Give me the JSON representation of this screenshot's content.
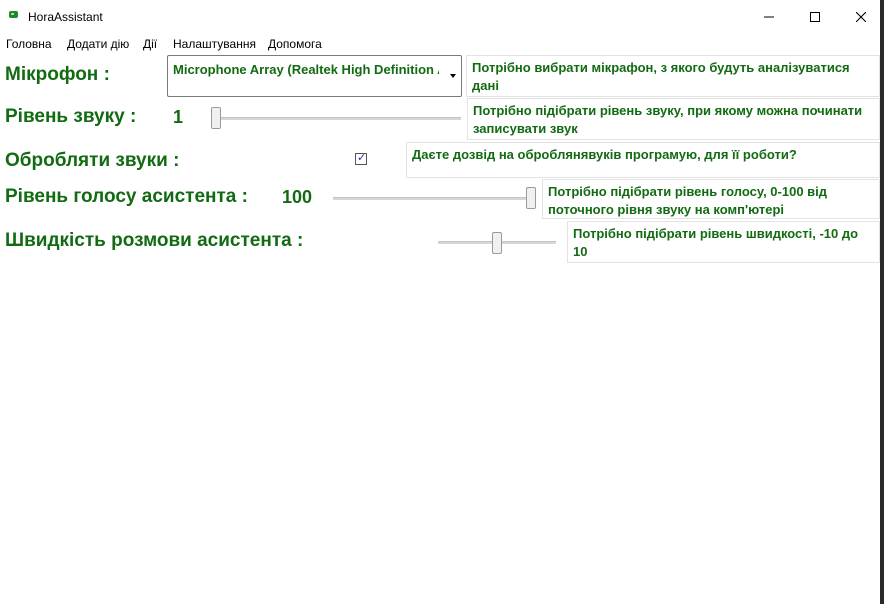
{
  "window": {
    "title": "HoraAssistant",
    "accent": "#126b12"
  },
  "menu": [
    "Головна",
    "Додати дію",
    "Дії",
    "Налаштування",
    "Допомога"
  ],
  "microphone": {
    "label": "Мікрофон :",
    "selected": "Microphone Array (Realtek High Definition Audio)",
    "hint": "Потрібно вибрати мікрафон, з якого будуть аналізуватися дані"
  },
  "sound_level": {
    "label": "Рівень звуку :",
    "value": "1",
    "slider_fraction": 0.0,
    "hint": "Потрібно підібрати рівень звуку, при якому можна починати записувати звук"
  },
  "process_sounds": {
    "label": "Обробляти звуки :",
    "checked": true,
    "check_glyph": "✓",
    "hint": "Даєте дозвід на оброблянявуків програмую, для її роботи?"
  },
  "voice_level": {
    "label": "Рівень голосу асистента :",
    "value": "100",
    "slider_fraction": 1.0,
    "hint": "Потрібно підібрати рівень голосу, 0-100 від поточного рівня звуку на комп'ютері"
  },
  "speech_speed": {
    "label": "Швидкість розмови асистента :",
    "slider_fraction": 0.5,
    "hint": "Потрібно підібрати рівень швидкості, -10 до 10"
  }
}
